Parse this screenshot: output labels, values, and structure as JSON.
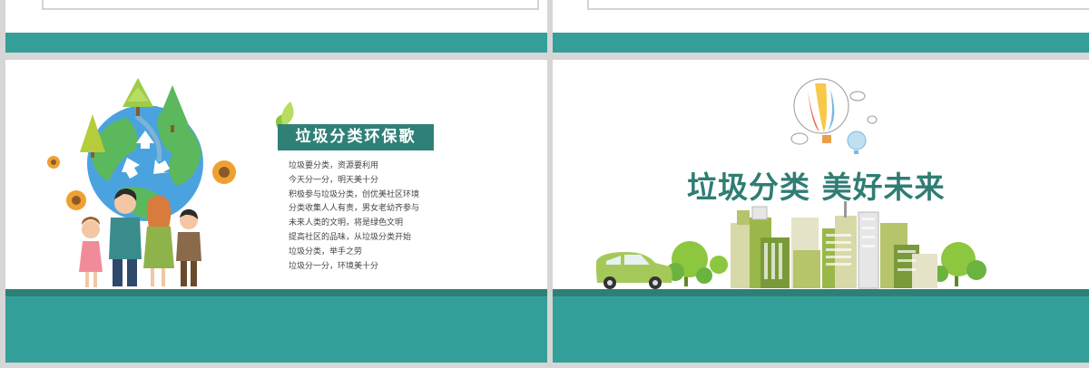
{
  "colors": {
    "teal": "#349f98",
    "teal_dark": "#2f7f79",
    "title_box": "#2f8178",
    "slogan_text": "#2f7d74",
    "tree_green": "#8dc63f",
    "building_green": "#9ab84a"
  },
  "slide_left": {
    "title": "垃圾分类环保歌",
    "poem_lines": [
      "垃圾要分类，资源要利用",
      "今天分一分，明天美十分",
      "积极参与垃圾分类，创优美社区环境",
      "分类收集人人有责，男女老幼齐参与",
      "未来人类的文明，将是绿色文明",
      "提高社区的品味，从垃圾分类开始",
      "垃圾分类，举手之劳",
      "垃圾分一分，环境美十分"
    ],
    "illustration": "earth-recycle-family"
  },
  "slide_right": {
    "slogan": "垃圾分类  美好未来",
    "illustration": "city-skyline-car-balloons"
  }
}
